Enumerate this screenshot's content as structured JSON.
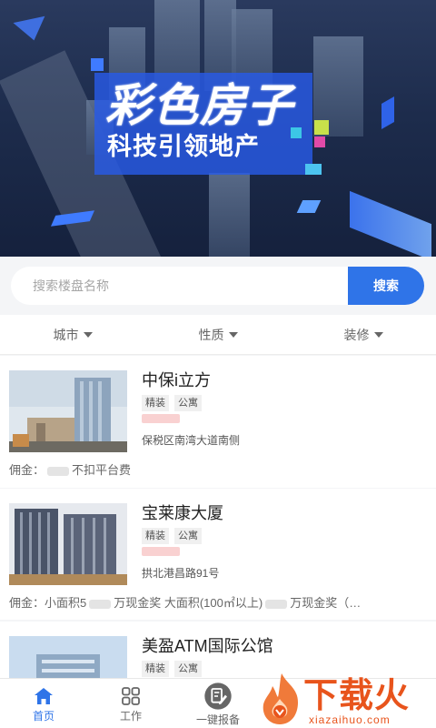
{
  "banner": {
    "title": "彩色房子",
    "subtitle": "科技引领地产"
  },
  "search": {
    "placeholder": "搜索楼盘名称",
    "button_label": "搜索"
  },
  "filters": [
    {
      "label": "城市"
    },
    {
      "label": "性质"
    },
    {
      "label": "装修"
    }
  ],
  "listings": [
    {
      "name": "中保i立方",
      "tags": [
        "精装",
        "公寓"
      ],
      "address": "保税区南湾大道南侧",
      "commission_prefix": "佣金：",
      "commission_suffix": "不扣平台费"
    },
    {
      "name": "宝莱康大厦",
      "tags": [
        "精装",
        "公寓"
      ],
      "address": "拱北港昌路91号",
      "commission_prefix": "佣金：小面积5",
      "commission_middle": "万现金奖 大面积(100㎡以上)",
      "commission_suffix": "万现金奖（…"
    },
    {
      "name": "美盈ATM国际公馆",
      "tags": [
        "精装",
        "公寓"
      ]
    }
  ],
  "tabbar": {
    "items": [
      {
        "label": "首页",
        "icon": "home-icon",
        "active": true
      },
      {
        "label": "工作",
        "icon": "grid-icon",
        "active": false
      },
      {
        "label": "一键报备",
        "icon": "edit-icon",
        "active": false
      }
    ]
  },
  "watermark": {
    "text": "下载火",
    "url": "xiazaihuo.com"
  },
  "colors": {
    "accent": "#2f74e8",
    "watermark": "#e8541c"
  }
}
